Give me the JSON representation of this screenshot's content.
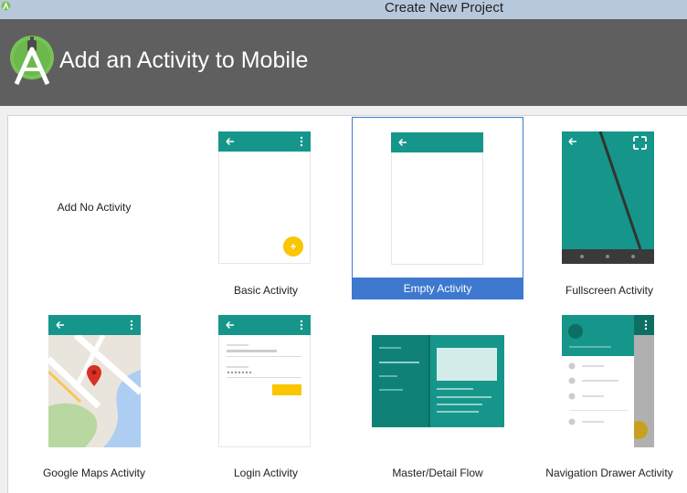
{
  "window": {
    "title": "Create New Project"
  },
  "header": {
    "title": "Add an Activity to Mobile"
  },
  "activities": [
    {
      "label": "Add No Activity"
    },
    {
      "label": "Basic Activity"
    },
    {
      "label": "Empty Activity",
      "selected": true
    },
    {
      "label": "Fullscreen Activity"
    },
    {
      "label": "Google Maps Activity"
    },
    {
      "label": "Login Activity"
    },
    {
      "label": "Master/Detail Flow"
    },
    {
      "label": "Navigation Drawer Activity"
    }
  ],
  "colors": {
    "accent_teal": "#16968a",
    "fab_yellow": "#f9c600",
    "selection_blue": "#3e78cf",
    "header_gray": "#5f5f5f",
    "android_green": "#78c257"
  }
}
